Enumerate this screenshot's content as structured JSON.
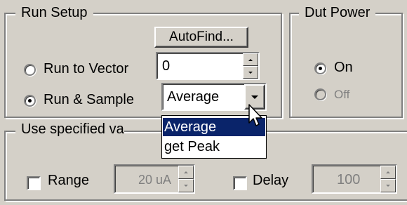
{
  "run_setup": {
    "title": "Run Setup",
    "autofind_label": "AutoFind...",
    "run_to_vector_label": "Run to Vector",
    "run_to_vector_selected": false,
    "vector_value": "0",
    "run_and_sample_label": "Run & Sample",
    "run_and_sample_selected": true,
    "sample_mode_value": "Average",
    "sample_mode_options": [
      "Average",
      "get Peak"
    ],
    "sample_mode_highlighted": "Average"
  },
  "dut_power": {
    "title": "Dut Power",
    "on_label": "On",
    "on_selected": true,
    "off_label": "Off",
    "off_selected": false
  },
  "use_specified": {
    "title": "Use  specified va",
    "range_label": "Range",
    "range_checked": false,
    "range_value": "20 uA",
    "delay_label": "Delay",
    "delay_checked": false,
    "delay_value": "100"
  },
  "icons": {
    "cursor": "mouse-pointer-icon",
    "dropdown_arrow": "chevron-down-icon",
    "spin_up": "spin-up-icon",
    "spin_down": "spin-down-icon"
  },
  "colors": {
    "background": "#d4d0c8",
    "selection": "#0a246a",
    "disabled_text": "#808080"
  }
}
